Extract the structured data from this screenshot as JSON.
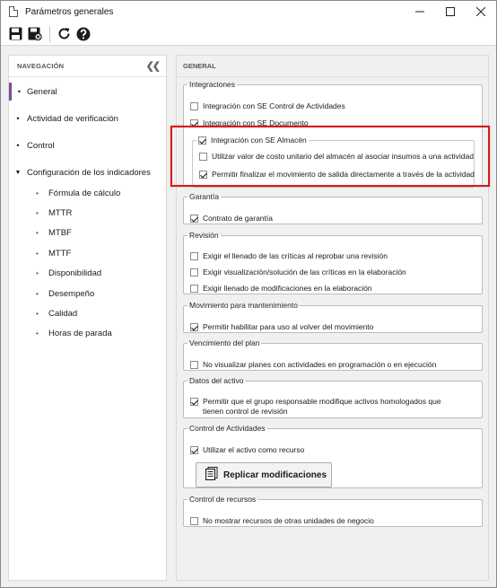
{
  "window": {
    "title": "Parámetros generales"
  },
  "toolbar": {
    "buttons": [
      {
        "name": "save-icon"
      },
      {
        "name": "save-close-icon"
      },
      {
        "name": "refresh-icon"
      },
      {
        "name": "help-icon"
      }
    ]
  },
  "nav": {
    "header": "NAVEGACIÓN",
    "items": [
      "General",
      "Actividad de verificación",
      "Control",
      "Configuración de los indicadores"
    ],
    "subitems": [
      "Fórmula de cálculo",
      "MTTR",
      "MTBF",
      "MTTF",
      "Disponibilidad",
      "Desempeño",
      "Calidad",
      "Horas de parada"
    ]
  },
  "main": {
    "header": "GENERAL",
    "integraciones": {
      "legend": "Integraciones",
      "opt1": "Integración con SE Control de Actividades",
      "opt2": "Integración con SE Documento",
      "almacen": {
        "legend": "Integración con SE Almacén",
        "opt1": "Utilizar valor de costo unitario del almacén al asociar insumos a una actividad",
        "opt2": "Permitir finalizar el movimiento de salida directamente a través de la actividad"
      }
    },
    "garantia": {
      "legend": "Garantía",
      "opt1": "Contrato de garantía"
    },
    "revision": {
      "legend": "Revisión",
      "opt1": "Exigir el llenado de las críticas al reprobar una revisión",
      "opt2": "Exigir visualización/solución de las críticas en la elaboración",
      "opt3": "Exigir llenado de modificaciones en la elaboración"
    },
    "movimiento": {
      "legend": "Movimiento para mantenimiento",
      "opt1": "Permitir habilitar para uso al volver del movimiento"
    },
    "vencimiento": {
      "legend": "Vencimiento del plan",
      "opt1": "No visualizar planes con actividades en programación o en ejecución"
    },
    "datos": {
      "legend": "Datos del activo",
      "opt1": "Permitir que el grupo responsable modifique activos homologados que tienen control de revisión"
    },
    "control_actividades": {
      "legend": "Control de Actividades",
      "opt1": "Utilizar el activo como recurso",
      "button": "Replicar modificaciones"
    },
    "control_recursos": {
      "legend": "Control de recursos",
      "opt1": "No mostrar recursos de otras unidades de negocio"
    }
  }
}
